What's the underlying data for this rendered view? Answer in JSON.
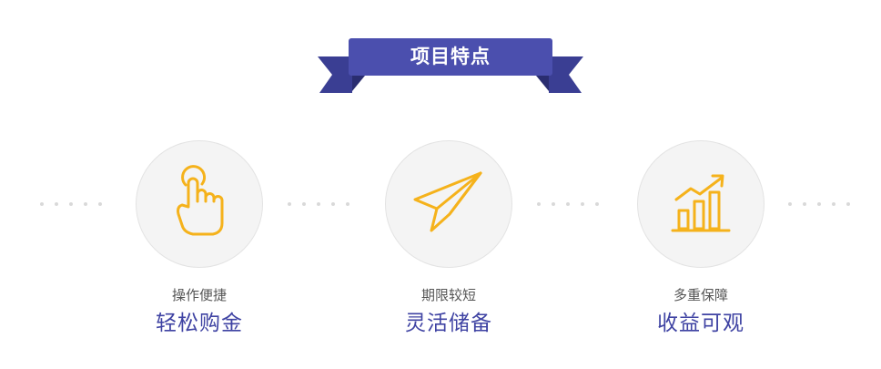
{
  "banner": {
    "title": "项目特点"
  },
  "features": [
    {
      "icon": "tap-hand-icon",
      "subtitle": "操作便捷",
      "title": "轻松购金"
    },
    {
      "icon": "paper-plane-icon",
      "subtitle": "期限较短",
      "title": "灵活储备"
    },
    {
      "icon": "growth-chart-icon",
      "subtitle": "多重保障",
      "title": "收益可观"
    }
  ],
  "colors": {
    "ribbon": "#4b4fae",
    "ribbon_dark": "#3a3e93",
    "icon": "#f5b21b",
    "title": "#3f43a3",
    "subtitle": "#555555",
    "circle": "#f4f4f4",
    "dots": "#d9d9d9"
  }
}
